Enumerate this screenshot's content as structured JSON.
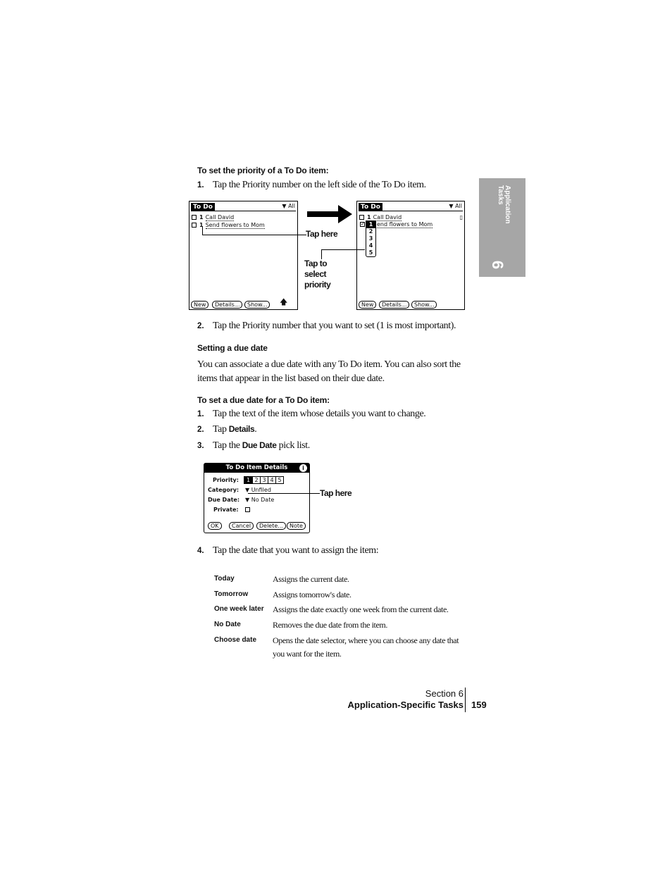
{
  "heading1": "To set the priority of a To Do item:",
  "steps1": [
    {
      "n": "1.",
      "text": "Tap the Priority number on the left side of the To Do item."
    },
    {
      "n": "2.",
      "text": "Tap the Priority number that you want to set (1 is most important)."
    }
  ],
  "screen1": {
    "title": "To Do",
    "category": "All",
    "items": [
      {
        "priority": "1",
        "text": "Call David"
      },
      {
        "priority": "1",
        "text": "Send flowers to Mom"
      }
    ],
    "buttons": [
      "New",
      "Details...",
      "Show..."
    ],
    "callout": "Tap here"
  },
  "screen2": {
    "title": "To Do",
    "category": "All",
    "items": [
      {
        "priority": "1",
        "text": "Call David"
      },
      {
        "priority": "",
        "text": "end flowers to Mom"
      }
    ],
    "priority_options": [
      "1",
      "2",
      "3",
      "4",
      "5"
    ],
    "buttons": [
      "New",
      "Details...",
      "Show..."
    ],
    "callout": "Tap to select priority"
  },
  "heading2": "Setting a due date",
  "para": [
    "You can associate a due date with any To Do item. You can also sort the",
    "items that appear in the list based on their due date."
  ],
  "heading3": "To set a due date for a To Do item:",
  "steps2": [
    {
      "n": "1.",
      "text": "Tap the text of the item whose details you want to change."
    },
    {
      "n": "2.",
      "pre": "Tap ",
      "bold": "Details",
      "post": "."
    },
    {
      "n": "3.",
      "pre": "Tap the ",
      "bold": "Due Date",
      "post": " pick list."
    }
  ],
  "dialog": {
    "title": "To Do Item Details",
    "priority_label": "Priority:",
    "priorities": [
      "1",
      "2",
      "3",
      "4",
      "5"
    ],
    "category_label": "Category:",
    "category": "Unfiled",
    "due_label": "Due Date:",
    "due": "No Date",
    "private_label": "Private:",
    "buttons": [
      "OK",
      "Cancel",
      "Delete...",
      "Note"
    ],
    "callout": "Tap here"
  },
  "step4": {
    "n": "4.",
    "text": "Tap the date that you want to assign the item:"
  },
  "options": [
    {
      "label": "Today",
      "desc": "Assigns the current date."
    },
    {
      "label": "Tomorrow",
      "desc": "Assigns tomorrow's date."
    },
    {
      "label": "One week later",
      "desc": "Assigns the date exactly one week from the current date."
    },
    {
      "label": "No Date",
      "desc": "Removes the due date from the item."
    },
    {
      "label": "Choose date",
      "desc": "Opens the date selector, where you can choose any date that you want for the item."
    }
  ],
  "sidetab": {
    "text1": "Application",
    "text2": "Tasks",
    "number": "6",
    "color": "#a6a6a6"
  },
  "footer": {
    "section": "Section 6",
    "title": "Application-Specific Tasks",
    "page": "159"
  }
}
